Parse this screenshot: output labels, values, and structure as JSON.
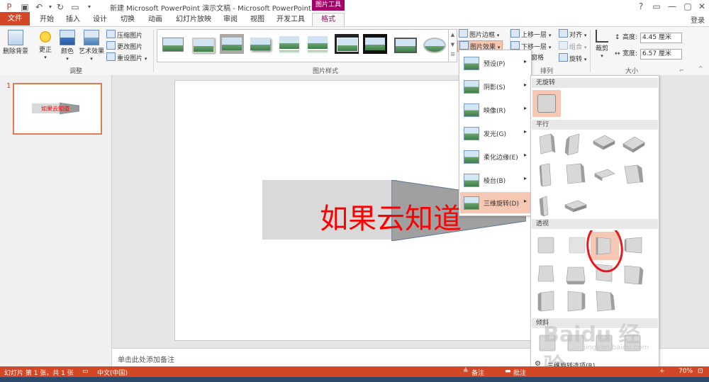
{
  "window": {
    "title": "新建 Microsoft PowerPoint 演示文稿 - Microsoft PowerPoint",
    "context_tab": "图片工具",
    "controls": [
      "?",
      "▭",
      "—",
      "▢",
      "✕"
    ],
    "login": "登录"
  },
  "tabs": [
    "文件",
    "开始",
    "插入",
    "设计",
    "切换",
    "动画",
    "幻灯片放映",
    "审阅",
    "视图",
    "开发工具",
    "格式"
  ],
  "ribbon": {
    "adjust": {
      "remove_bg": "删除背景",
      "corrections": "更正",
      "color": "颜色",
      "art_effects": "艺术效果",
      "compress": "压缩图片",
      "change": "更改图片",
      "reset": "重设图片",
      "label": "调整"
    },
    "styles_label": "图片样式",
    "border": "图片边框",
    "effects": "图片效果",
    "arrange": {
      "bring_forward": "上移一层",
      "send_backward": "下移一层",
      "selection_pane": "窗格",
      "grid_label": "格",
      "align": "对齐",
      "group": "组合",
      "rotate": "旋转",
      "label": "排列"
    },
    "size": {
      "crop": "裁剪",
      "height_label": "高度:",
      "height_value": "4.45 厘米",
      "width_label": "宽度:",
      "width_value": "6.57 厘米",
      "label": "大小"
    }
  },
  "slides_panel": {
    "number": "1",
    "thumb_text": "如果云知道"
  },
  "slide": {
    "text": "如果云知道"
  },
  "notes_placeholder": "单击此处添加备注",
  "status": {
    "slide_info": "幻灯片 第 1 张，共 1 张",
    "language": "中文(中国)",
    "notes": "备注",
    "comments": "批注",
    "zoom": "70%"
  },
  "effects_menu": [
    {
      "label": "预设(P)"
    },
    {
      "label": "阴影(S)"
    },
    {
      "label": "映像(R)"
    },
    {
      "label": "发光(G)"
    },
    {
      "label": "柔化边缘(E)"
    },
    {
      "label": "棱台(B)"
    },
    {
      "label": "三维旋转(D)"
    }
  ],
  "rotation_panel": {
    "no_rotation": "无旋转",
    "parallel": "平行",
    "perspective": "透视",
    "oblique": "倾斜",
    "options": "三维旋转选项(R)..."
  },
  "watermark": {
    "brand": "Baidu 经验",
    "url": "jingyan.baidu.com"
  },
  "colors": {
    "accent": "#d24726",
    "context": "#a4006b",
    "selection": "#f6c8b3",
    "highlight_circle": "#e8171f"
  }
}
